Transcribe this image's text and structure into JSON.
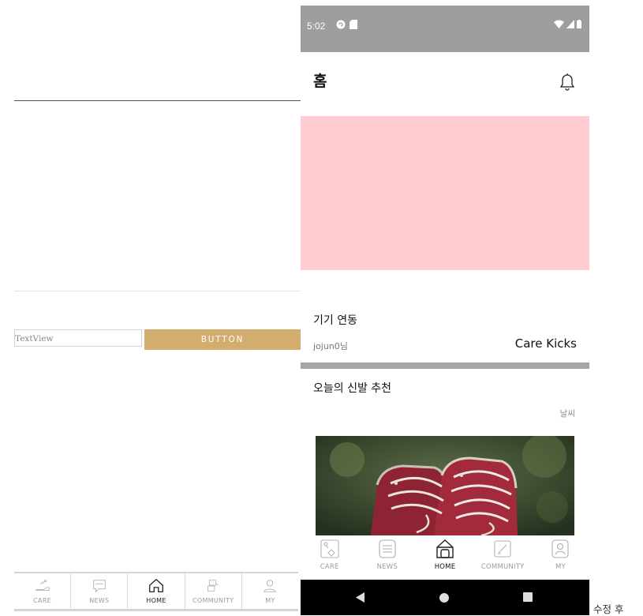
{
  "editor": {
    "textview": "TextView",
    "button": "BUTTON",
    "nav": [
      {
        "label": "CARE",
        "icon": "care-icon"
      },
      {
        "label": "NEWS",
        "icon": "news-icon"
      },
      {
        "label": "HOME",
        "icon": "home-icon",
        "active": true
      },
      {
        "label": "COMMUNITY",
        "icon": "community-icon"
      },
      {
        "label": "MY",
        "icon": "my-icon"
      }
    ]
  },
  "phone": {
    "status": {
      "time": "5:02",
      "icons": [
        "sync-icon",
        "sd-card-icon",
        "wifi-icon",
        "signal-icon",
        "battery-icon"
      ]
    },
    "appbar": {
      "title": "홈",
      "icon": "bell-icon"
    },
    "banner_color": "#ffccd1",
    "device": {
      "title": "기기 연동",
      "user": "jojun0님",
      "name": "Care Kicks"
    },
    "shoe": {
      "title": "오늘의 신발 추천",
      "weather": "날씨",
      "image": "sneakers-photo"
    },
    "tabs": [
      {
        "label": "CARE",
        "icon": "care-icon"
      },
      {
        "label": "NEWS",
        "icon": "news-icon"
      },
      {
        "label": "HOME",
        "icon": "home-icon",
        "active": true
      },
      {
        "label": "COMMUNITY",
        "icon": "community-icon"
      },
      {
        "label": "MY",
        "icon": "my-icon"
      }
    ],
    "system_nav": [
      "back-icon",
      "home-circle-icon",
      "recents-icon"
    ]
  },
  "caption": "수정 후",
  "colors": {
    "accent": "#d2ad6e",
    "status_bar": "#9e9e9e",
    "divider": "#a5a5a5"
  }
}
